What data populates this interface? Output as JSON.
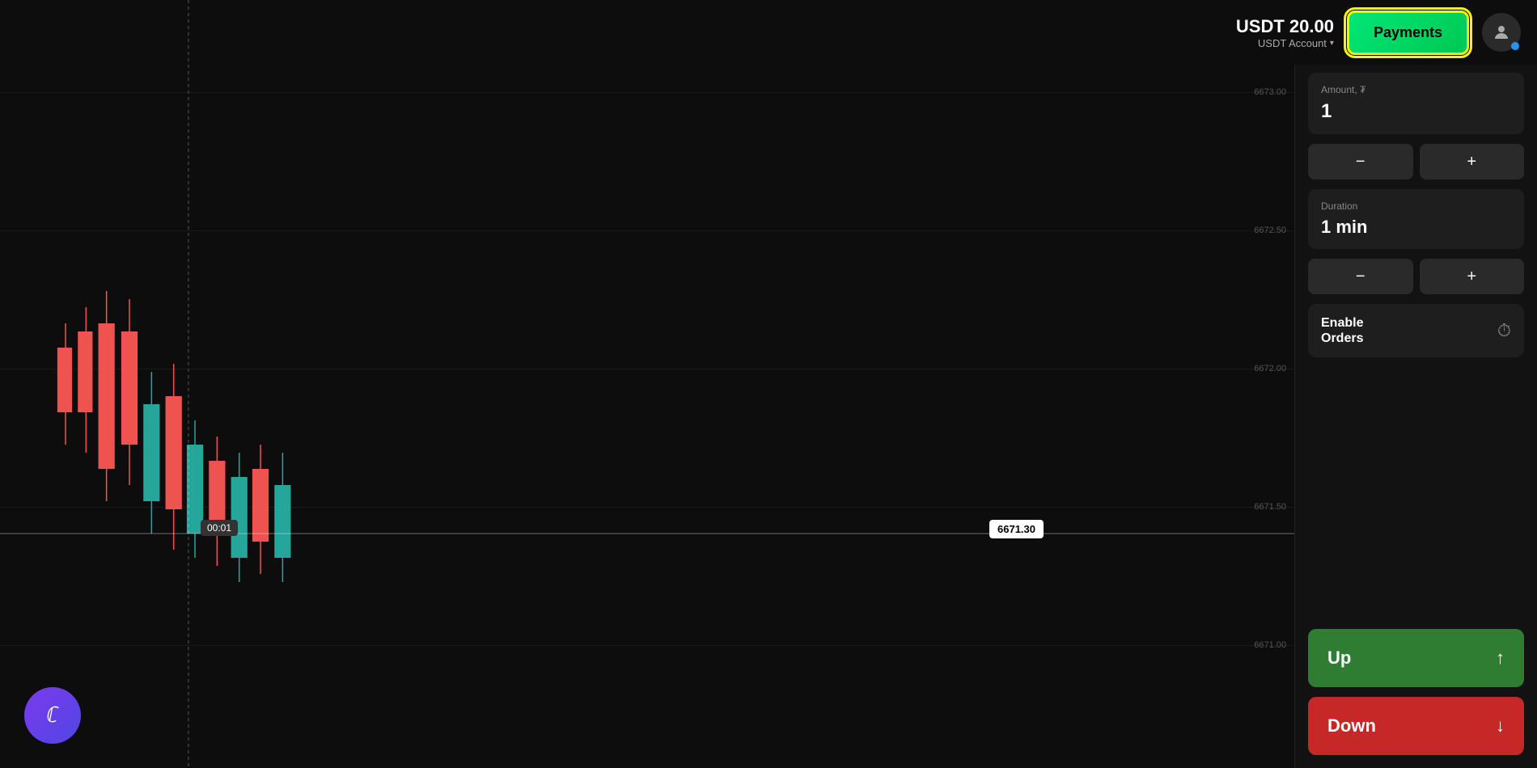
{
  "header": {
    "balance": "USDT 20.00",
    "account_type": "USDT Account",
    "payments_label": "Payments",
    "chevron": "▾"
  },
  "chart": {
    "price_labels": [
      "6673.00",
      "6672.50",
      "6672.00",
      "6671.50",
      "6671.00"
    ],
    "current_price": "6671.30",
    "time_label": "00:01",
    "crosshair_price": "6671.30"
  },
  "sidebar": {
    "amount_label": "Amount, ₮",
    "amount_value": "1",
    "duration_label": "Duration",
    "duration_value": "1 min",
    "minus_label": "−",
    "plus_label": "+",
    "enable_orders_label": "Enable\nOrders",
    "up_label": "Up",
    "down_label": "Down",
    "up_arrow": "↑",
    "down_arrow": "↓"
  },
  "logo": {
    "text": "ℂ"
  },
  "colors": {
    "up_bg": "#2e7d32",
    "down_bg": "#c62828",
    "payments_bg": "#00e676",
    "payments_border": "#f5f500",
    "accent_blue": "#2196f3",
    "logo_gradient_start": "#7c3aed",
    "logo_gradient_end": "#4f46e5"
  }
}
